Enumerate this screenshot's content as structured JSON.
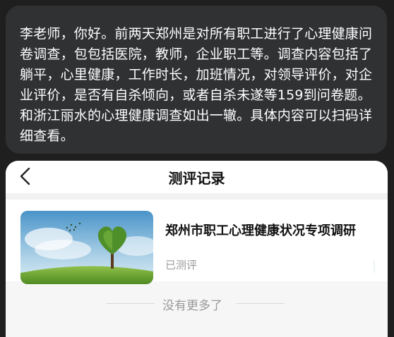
{
  "message": {
    "text": "李老师，你好。前两天郑州是对所有职工进行了心理健康问卷调查，包包括医院，教师，企业职工等。调查内容包括了躺平，心里健康，工作时长，加班情况，对领导评价，对企业评价，是否有自杀倾向，或者自杀未遂等159到问卷题。和浙江丽水的心理健康调查如出一辙。具体内容可以扫码详细查看。"
  },
  "app": {
    "title": "测评记录",
    "back_icon": "chevron-left-icon"
  },
  "survey": {
    "title": "郑州市职工心理健康状况专项调研",
    "status": "已测评",
    "image_icon": "heart-tree-image"
  },
  "footer": {
    "no_more": "没有更多了"
  },
  "colors": {
    "chat_bg": "#1f1f1f",
    "bubble_bg": "#2f3133",
    "page_bg": "#f6f6f6",
    "muted_text": "#9a9a9a"
  }
}
